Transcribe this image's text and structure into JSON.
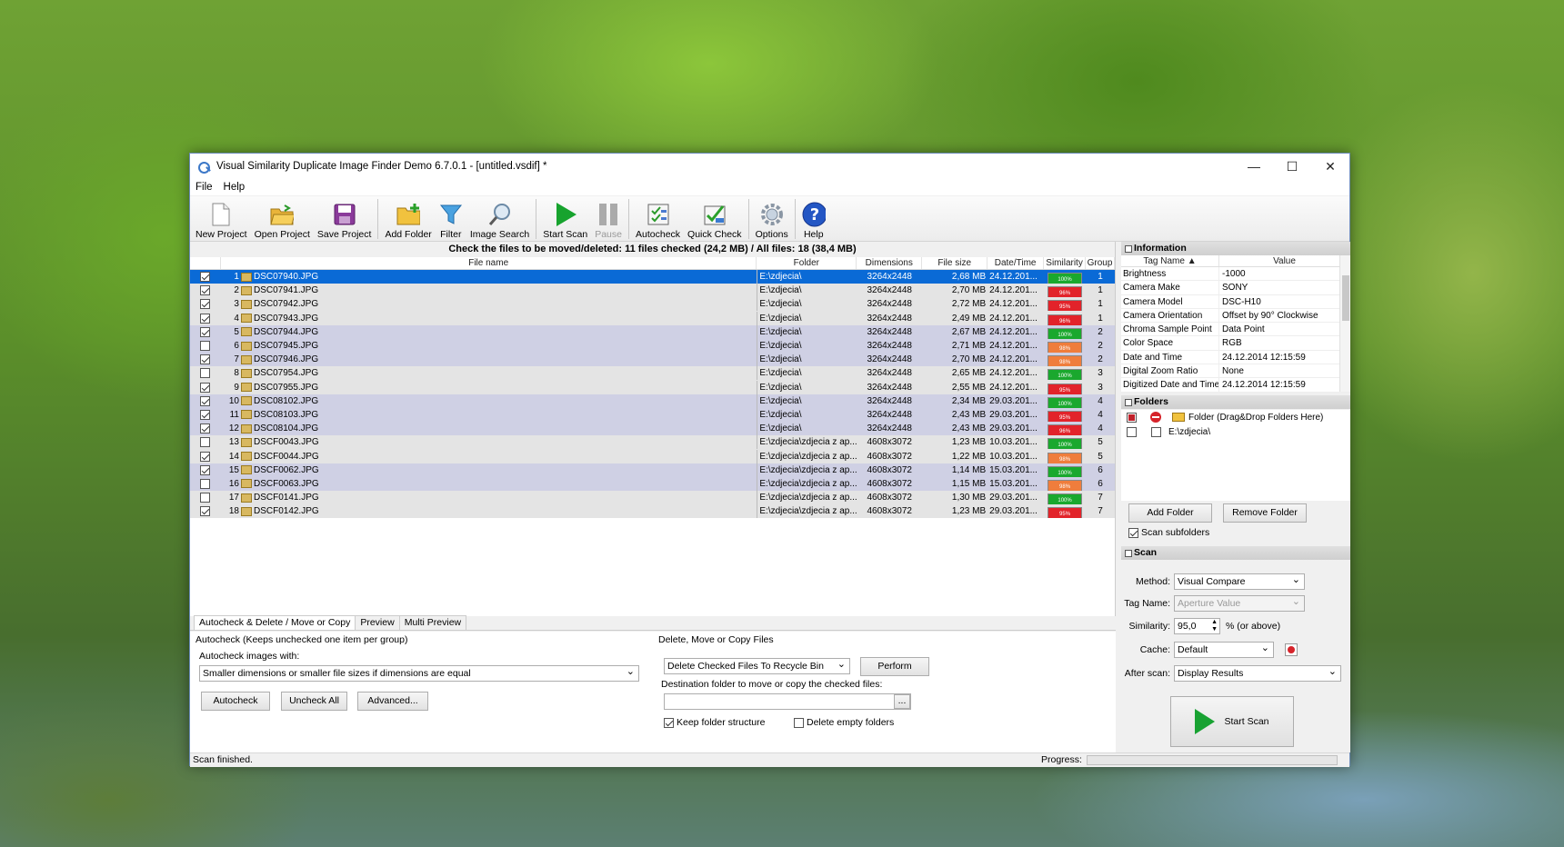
{
  "window": {
    "title": "Visual Similarity Duplicate Image Finder Demo 6.7.0.1 - [untitled.vsdif] *"
  },
  "menu": [
    "File",
    "Help"
  ],
  "toolbar": [
    {
      "label": "New Project",
      "icon": "new-project-icon"
    },
    {
      "label": "Open Project",
      "icon": "open-project-icon"
    },
    {
      "label": "Save Project",
      "icon": "save-project-icon"
    },
    {
      "label": "Add Folder",
      "icon": "add-folder-icon"
    },
    {
      "label": "Filter",
      "icon": "filter-icon"
    },
    {
      "label": "Image Search",
      "icon": "image-search-icon"
    },
    {
      "label": "Start Scan",
      "icon": "start-scan-icon"
    },
    {
      "label": "Pause",
      "icon": "pause-icon"
    },
    {
      "label": "Autocheck",
      "icon": "autocheck-icon"
    },
    {
      "label": "Quick Check",
      "icon": "quick-check-icon"
    },
    {
      "label": "Options",
      "icon": "options-icon"
    },
    {
      "label": "Help",
      "icon": "help-icon"
    }
  ],
  "results": {
    "info": "Check the files to be moved/deleted: 11 files checked (24,2 MB) / All files: 18 (38,4 MB)",
    "columns": [
      "File name",
      "Folder",
      "Dimensions",
      "File size",
      "Date/Time",
      "Similarity",
      "Group"
    ],
    "rows": [
      {
        "n": "1",
        "name": "DSC07940.JPG",
        "folder": "E:\\zdjecia\\",
        "dim": "3264x2448",
        "size": "2,68 MB",
        "dt": "24.12.201...",
        "sim": "100%",
        "grp": "1",
        "checked": true
      },
      {
        "n": "2",
        "name": "DSC07941.JPG",
        "folder": "E:\\zdjecia\\",
        "dim": "3264x2448",
        "size": "2,70 MB",
        "dt": "24.12.201...",
        "sim": "96%",
        "grp": "1",
        "checked": true
      },
      {
        "n": "3",
        "name": "DSC07942.JPG",
        "folder": "E:\\zdjecia\\",
        "dim": "3264x2448",
        "size": "2,72 MB",
        "dt": "24.12.201...",
        "sim": "95%",
        "grp": "1",
        "checked": true
      },
      {
        "n": "4",
        "name": "DSC07943.JPG",
        "folder": "E:\\zdjecia\\",
        "dim": "3264x2448",
        "size": "2,49 MB",
        "dt": "24.12.201...",
        "sim": "96%",
        "grp": "1",
        "checked": true
      },
      {
        "n": "5",
        "name": "DSC07944.JPG",
        "folder": "E:\\zdjecia\\",
        "dim": "3264x2448",
        "size": "2,67 MB",
        "dt": "24.12.201...",
        "sim": "100%",
        "grp": "2",
        "checked": true
      },
      {
        "n": "6",
        "name": "DSC07945.JPG",
        "folder": "E:\\zdjecia\\",
        "dim": "3264x2448",
        "size": "2,71 MB",
        "dt": "24.12.201...",
        "sim": "98%",
        "grp": "2",
        "checked": false
      },
      {
        "n": "7",
        "name": "DSC07946.JPG",
        "folder": "E:\\zdjecia\\",
        "dim": "3264x2448",
        "size": "2,70 MB",
        "dt": "24.12.201...",
        "sim": "98%",
        "grp": "2",
        "checked": true
      },
      {
        "n": "8",
        "name": "DSC07954.JPG",
        "folder": "E:\\zdjecia\\",
        "dim": "3264x2448",
        "size": "2,65 MB",
        "dt": "24.12.201...",
        "sim": "100%",
        "grp": "3",
        "checked": false
      },
      {
        "n": "9",
        "name": "DSC07955.JPG",
        "folder": "E:\\zdjecia\\",
        "dim": "3264x2448",
        "size": "2,55 MB",
        "dt": "24.12.201...",
        "sim": "95%",
        "grp": "3",
        "checked": true
      },
      {
        "n": "10",
        "name": "DSC08102.JPG",
        "folder": "E:\\zdjecia\\",
        "dim": "3264x2448",
        "size": "2,34 MB",
        "dt": "29.03.201...",
        "sim": "100%",
        "grp": "4",
        "checked": true
      },
      {
        "n": "11",
        "name": "DSC08103.JPG",
        "folder": "E:\\zdjecia\\",
        "dim": "3264x2448",
        "size": "2,43 MB",
        "dt": "29.03.201...",
        "sim": "95%",
        "grp": "4",
        "checked": true
      },
      {
        "n": "12",
        "name": "DSC08104.JPG",
        "folder": "E:\\zdjecia\\",
        "dim": "3264x2448",
        "size": "2,43 MB",
        "dt": "29.03.201...",
        "sim": "96%",
        "grp": "4",
        "checked": true
      },
      {
        "n": "13",
        "name": "DSCF0043.JPG",
        "folder": "E:\\zdjecia\\zdjecia z ap...",
        "dim": "4608x3072",
        "size": "1,23 MB",
        "dt": "10.03.201...",
        "sim": "100%",
        "grp": "5",
        "checked": false
      },
      {
        "n": "14",
        "name": "DSCF0044.JPG",
        "folder": "E:\\zdjecia\\zdjecia z ap...",
        "dim": "4608x3072",
        "size": "1,22 MB",
        "dt": "10.03.201...",
        "sim": "98%",
        "grp": "5",
        "checked": true
      },
      {
        "n": "15",
        "name": "DSCF0062.JPG",
        "folder": "E:\\zdjecia\\zdjecia z ap...",
        "dim": "4608x3072",
        "size": "1,14 MB",
        "dt": "15.03.201...",
        "sim": "100%",
        "grp": "6",
        "checked": true
      },
      {
        "n": "16",
        "name": "DSCF0063.JPG",
        "folder": "E:\\zdjecia\\zdjecia z ap...",
        "dim": "4608x3072",
        "size": "1,15 MB",
        "dt": "15.03.201...",
        "sim": "98%",
        "grp": "6",
        "checked": false
      },
      {
        "n": "17",
        "name": "DSCF0141.JPG",
        "folder": "E:\\zdjecia\\zdjecia z ap...",
        "dim": "4608x3072",
        "size": "1,30 MB",
        "dt": "29.03.201...",
        "sim": "100%",
        "grp": "7",
        "checked": false
      },
      {
        "n": "18",
        "name": "DSCF0142.JPG",
        "folder": "E:\\zdjecia\\zdjecia z ap...",
        "dim": "4608x3072",
        "size": "1,23 MB",
        "dt": "29.03.201...",
        "sim": "95%",
        "grp": "7",
        "checked": true
      }
    ]
  },
  "bottom": {
    "tabs": [
      "Autocheck & Delete / Move or Copy",
      "Preview",
      "Multi Preview"
    ],
    "autocheck_group": "Autocheck (Keeps unchecked one item per group)",
    "autocheck_with_label": "Autocheck images with:",
    "autocheck_rule": "Smaller dimensions or smaller file sizes if dimensions are equal",
    "autocheck_btn": "Autocheck",
    "uncheck_all_btn": "Uncheck All",
    "advanced_btn": "Advanced...",
    "dmc_group": "Delete, Move or Copy Files",
    "action": "Delete Checked Files To Recycle Bin",
    "perform_btn": "Perform",
    "dest_label": "Destination folder to move or copy the checked files:",
    "dest_value": "",
    "browse_btn": "...",
    "keep_structure": "Keep folder structure",
    "delete_empty": "Delete empty folders"
  },
  "status": {
    "text": "Scan finished.",
    "progress_label": "Progress:"
  },
  "info_panel": {
    "title": "Information",
    "col_tag": "Tag Name",
    "col_value": "Value",
    "rows": [
      {
        "tag": "Brightness",
        "value": "-1000"
      },
      {
        "tag": "Camera Make",
        "value": "SONY"
      },
      {
        "tag": "Camera Model",
        "value": "DSC-H10"
      },
      {
        "tag": "Camera Orientation",
        "value": "Offset by 90° Clockwise"
      },
      {
        "tag": "Chroma Sample Point",
        "value": "Data Point"
      },
      {
        "tag": "Color Space",
        "value": "RGB"
      },
      {
        "tag": "Date and Time",
        "value": "24.12.2014 12:15:59"
      },
      {
        "tag": "Digital Zoom Ratio",
        "value": "None"
      },
      {
        "tag": "Digitized Date and Time",
        "value": "24.12.2014 12:15:59"
      }
    ]
  },
  "folders_panel": {
    "title": "Folders",
    "rows": [
      {
        "label": "Folder (Drag&Drop Folders Here)"
      },
      {
        "label": "E:\\zdjecia\\"
      }
    ],
    "add_btn": "Add Folder",
    "remove_btn": "Remove Folder",
    "scan_subfolders": "Scan subfolders"
  },
  "scan_panel": {
    "title": "Scan",
    "method_label": "Method:",
    "method": "Visual Compare",
    "tag_label": "Tag Name:",
    "tag": "Aperture Value",
    "sim_label": "Similarity:",
    "sim": "95,0",
    "sim_unit": "% (or above)",
    "cache_label": "Cache:",
    "cache": "Default",
    "after_label": "After scan:",
    "after": "Display Results",
    "start_btn": "Start Scan"
  },
  "colors": {
    "selected_row": "#0a6ad6",
    "sim_100": "#1aa82e",
    "sim_high": "#ef7d3c",
    "sim_low": "#e2232a"
  }
}
